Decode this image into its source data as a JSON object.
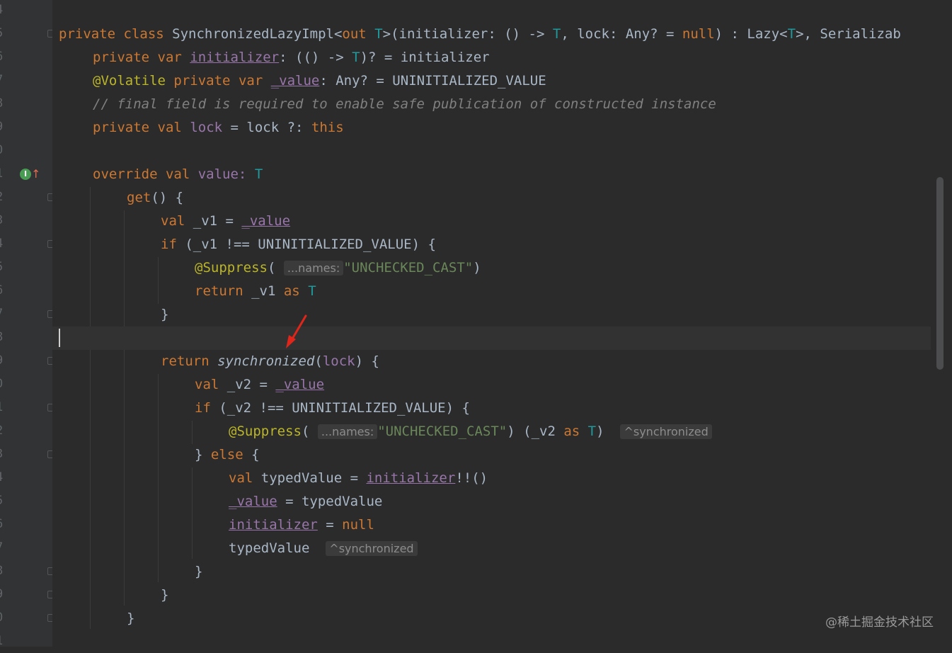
{
  "gutter": {
    "line_numbers": [
      "4",
      "5",
      "6",
      "7",
      "8",
      "9",
      "0",
      "1",
      "2",
      "3",
      "4",
      "5",
      "6",
      "7",
      "8",
      "9",
      "0",
      "1",
      "2",
      "3",
      "4",
      "5",
      "6",
      "7",
      "8",
      "9",
      "0",
      "1"
    ],
    "override_marker_label": "I"
  },
  "code": {
    "l1": {
      "t1": "private",
      "t2": " ",
      "t3": "class",
      "t4": " SynchronizedLazyImpl<",
      "t5": "out",
      "t6": " ",
      "t7": "T",
      "t8": ">(initializer: () -> ",
      "t9": "T",
      "t10": ", lock: Any? = ",
      "t11": "null",
      "t12": ") : Lazy<",
      "t13": "T",
      "t14": ">, Serializab"
    },
    "l2": {
      "t1": "private",
      "t2": " ",
      "t3": "var",
      "t4": " ",
      "t5": "initializer",
      "t6": ": (() -> ",
      "t7": "T",
      "t8": ")? = initializer"
    },
    "l3": {
      "t1": "@Volatile",
      "t2": " ",
      "t3": "private",
      "t4": " ",
      "t5": "var",
      "t6": " ",
      "t7": "_value",
      "t8": ": Any? = UNINITIALIZED_VALUE"
    },
    "l4": {
      "t1": "// final field is required to enable safe publication of constructed instance"
    },
    "l5": {
      "t1": "private",
      "t2": " ",
      "t3": "val",
      "t4": " ",
      "t5": "lock",
      "t6": " = lock ?: ",
      "t7": "this"
    },
    "l6": {
      "t1": ""
    },
    "l7": {
      "t1": "override",
      "t2": " ",
      "t3": "val",
      "t4": " value: ",
      "t5": "T"
    },
    "l8": {
      "t1": "get",
      "t2": "() {"
    },
    "l9": {
      "t1": "val",
      "t2": " _v1 = ",
      "t3": "_value"
    },
    "l10": {
      "t1": "if",
      "t2": " (_v1 !== UNINITIALIZED_VALUE) {"
    },
    "l11": {
      "t1": "@Suppress",
      "t2": "(",
      "t3": "...names:",
      "t4": "\"UNCHECKED_CAST\"",
      "t5": ")"
    },
    "l12": {
      "t1": "return",
      "t2": " _v1 ",
      "t3": "as",
      "t4": " ",
      "t5": "T"
    },
    "l13": {
      "t1": "}"
    },
    "l14": {
      "t1": ""
    },
    "l15": {
      "t1": "return",
      "t2": " ",
      "t3": "synchronized",
      "t4": "(",
      "t5": "lock",
      "t6": ") {"
    },
    "l16": {
      "t1": "val",
      "t2": " _v2 = ",
      "t3": "_value"
    },
    "l17": {
      "t1": "if",
      "t2": " (_v2 !== UNINITIALIZED_VALUE) {"
    },
    "l18": {
      "t1": "@Suppress",
      "t2": "(",
      "t3": "...names:",
      "t4": "\"UNCHECKED_CAST\"",
      "t5": ") (_v2 ",
      "t6": "as",
      "t7": " ",
      "t8": "T",
      "t9": ")",
      "t10": "^synchronized"
    },
    "l19": {
      "t1": "} ",
      "t2": "else",
      "t3": " {"
    },
    "l20": {
      "t1": "val",
      "t2": " typedValue = ",
      "t3": "initializer",
      "t4": "!!()"
    },
    "l21": {
      "t1": "_value",
      "t2": " = typedValue"
    },
    "l22": {
      "t1": "initializer",
      "t2": " = ",
      "t3": "null"
    },
    "l23": {
      "t1": "typedValue",
      "t2": "^synchronized"
    },
    "l24": {
      "t1": "}"
    },
    "l25": {
      "t1": "}"
    },
    "l26": {
      "t1": "}"
    }
  },
  "watermark": "@稀土掘金技术社区",
  "colors": {
    "background": "#2b2b2b",
    "keyword": "#cc7832",
    "type_param": "#20999d",
    "annotation": "#bbb529",
    "string": "#6a8759",
    "property": "#9876aa",
    "comment": "#808080",
    "arrow": "#e0261b"
  }
}
